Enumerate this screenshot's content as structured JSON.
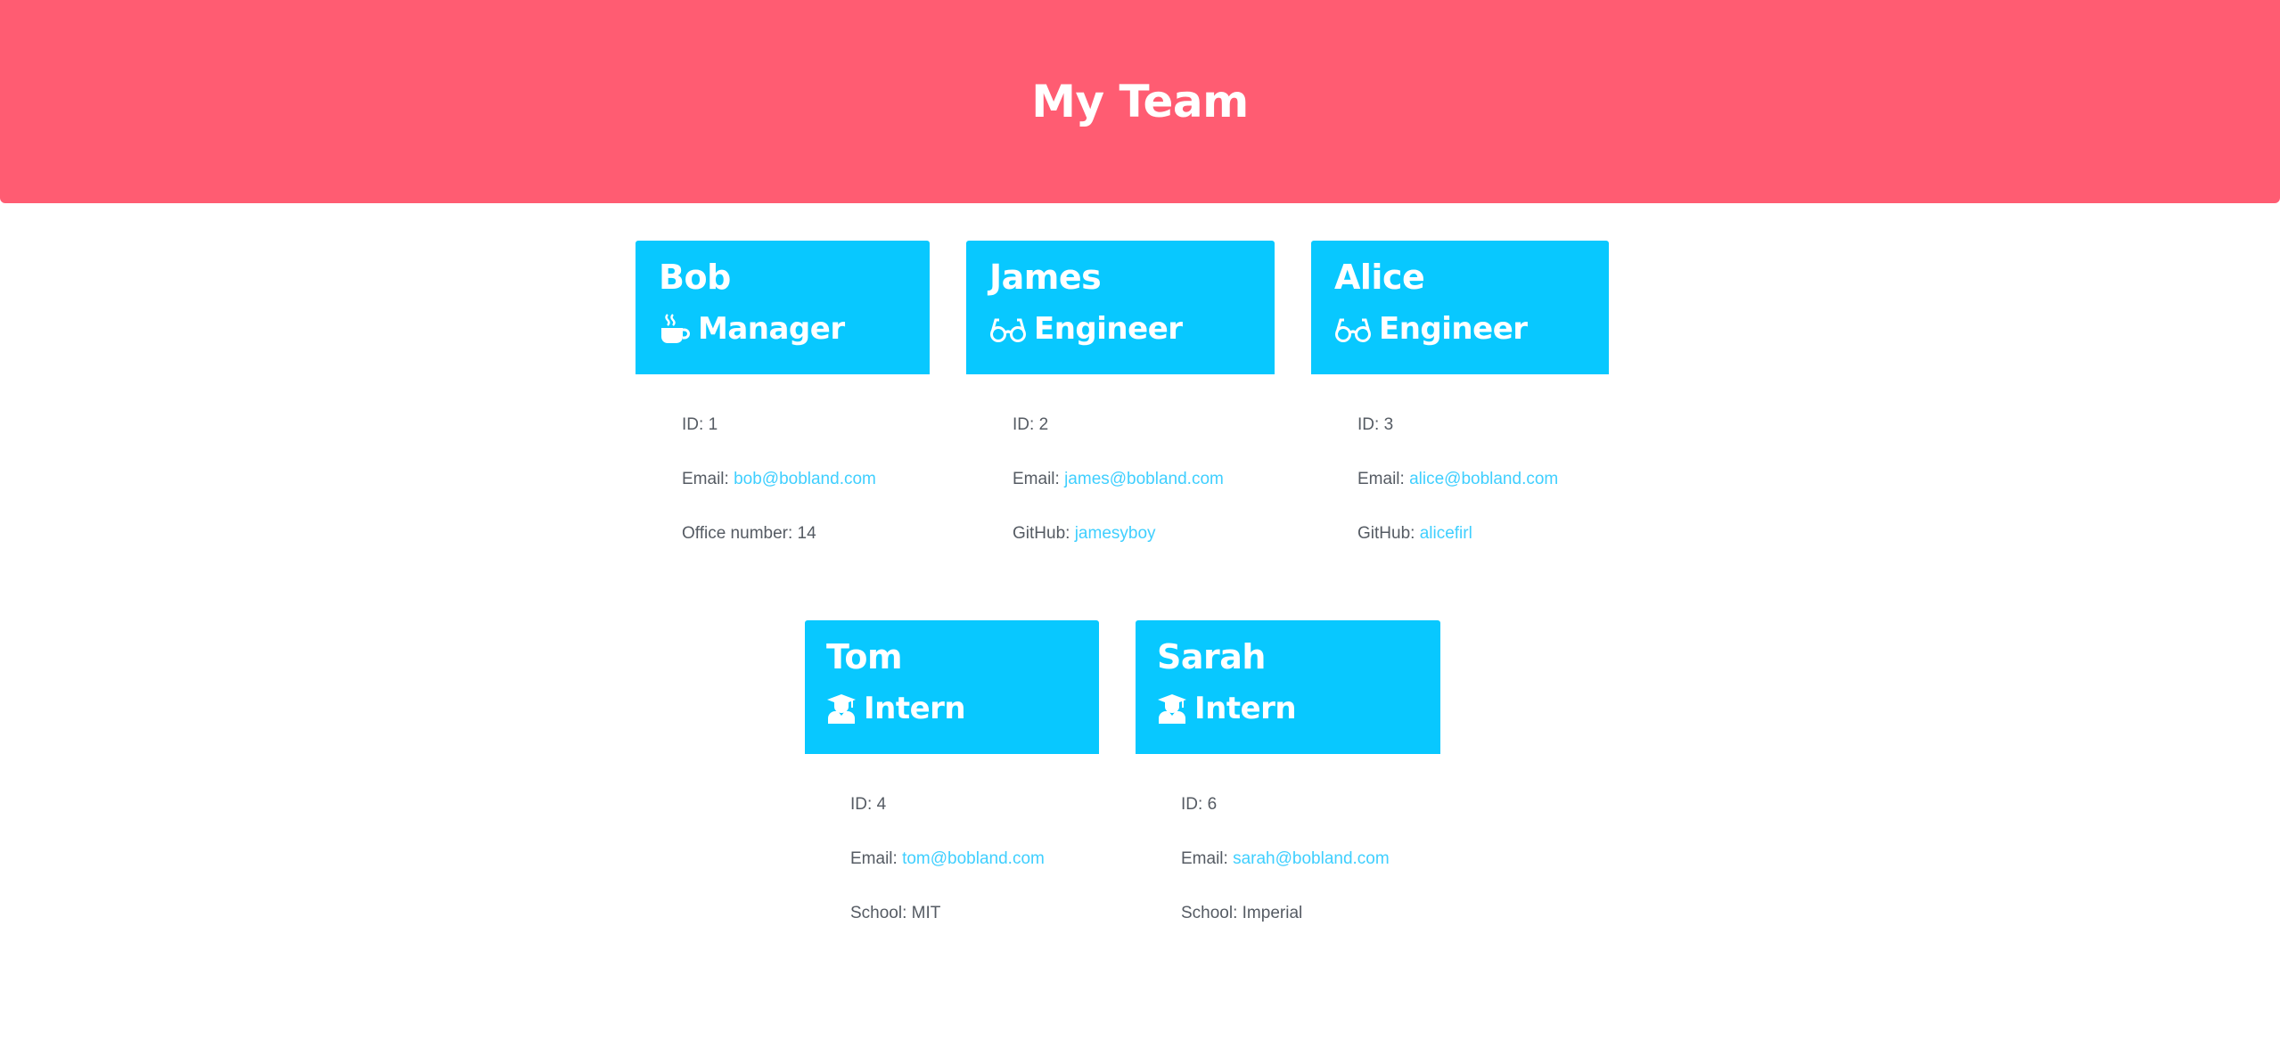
{
  "header": {
    "title": "My Team"
  },
  "members": [
    {
      "name": "Bob",
      "role": "Manager",
      "icon": "coffee-icon",
      "id_label": "ID:",
      "id": "1",
      "email_label": "Email:",
      "email": "bob@bobland.com",
      "extra_label": "Office number:",
      "extra": "14",
      "extra_is_link": false
    },
    {
      "name": "James",
      "role": "Engineer",
      "icon": "glasses-icon",
      "id_label": "ID:",
      "id": "2",
      "email_label": "Email:",
      "email": "james@bobland.com",
      "extra_label": "GitHub:",
      "extra": "jamesyboy",
      "extra_is_link": true
    },
    {
      "name": "Alice",
      "role": "Engineer",
      "icon": "glasses-icon",
      "id_label": "ID:",
      "id": "3",
      "email_label": "Email:",
      "email": "alice@bobland.com",
      "extra_label": "GitHub:",
      "extra": "alicefirl",
      "extra_is_link": true
    },
    {
      "name": "Tom",
      "role": "Intern",
      "icon": "graduate-icon",
      "id_label": "ID:",
      "id": "4",
      "email_label": "Email:",
      "email": "tom@bobland.com",
      "extra_label": "School:",
      "extra": "MIT",
      "extra_is_link": false
    },
    {
      "name": "Sarah",
      "role": "Intern",
      "icon": "graduate-icon",
      "id_label": "ID:",
      "id": "6",
      "email_label": "Email:",
      "email": "sarah@bobland.com",
      "extra_label": "School:",
      "extra": "Imperial",
      "extra_is_link": false
    }
  ],
  "colors": {
    "header_bg": "#ff5c72",
    "card_head_bg": "#08c8ff",
    "link": "#3fcfff",
    "body_text": "#555b63"
  }
}
